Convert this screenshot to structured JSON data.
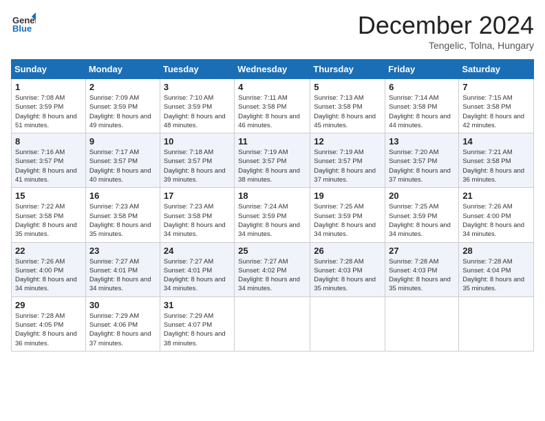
{
  "header": {
    "logo_line1": "General",
    "logo_line2": "Blue",
    "month_title": "December 2024",
    "location": "Tengelic, Tolna, Hungary"
  },
  "weekdays": [
    "Sunday",
    "Monday",
    "Tuesday",
    "Wednesday",
    "Thursday",
    "Friday",
    "Saturday"
  ],
  "weeks": [
    [
      {
        "day": "1",
        "sunrise": "7:08 AM",
        "sunset": "3:59 PM",
        "daylight": "8 hours and 51 minutes."
      },
      {
        "day": "2",
        "sunrise": "7:09 AM",
        "sunset": "3:59 PM",
        "daylight": "8 hours and 49 minutes."
      },
      {
        "day": "3",
        "sunrise": "7:10 AM",
        "sunset": "3:59 PM",
        "daylight": "8 hours and 48 minutes."
      },
      {
        "day": "4",
        "sunrise": "7:11 AM",
        "sunset": "3:58 PM",
        "daylight": "8 hours and 46 minutes."
      },
      {
        "day": "5",
        "sunrise": "7:13 AM",
        "sunset": "3:58 PM",
        "daylight": "8 hours and 45 minutes."
      },
      {
        "day": "6",
        "sunrise": "7:14 AM",
        "sunset": "3:58 PM",
        "daylight": "8 hours and 44 minutes."
      },
      {
        "day": "7",
        "sunrise": "7:15 AM",
        "sunset": "3:58 PM",
        "daylight": "8 hours and 42 minutes."
      }
    ],
    [
      {
        "day": "8",
        "sunrise": "7:16 AM",
        "sunset": "3:57 PM",
        "daylight": "8 hours and 41 minutes."
      },
      {
        "day": "9",
        "sunrise": "7:17 AM",
        "sunset": "3:57 PM",
        "daylight": "8 hours and 40 minutes."
      },
      {
        "day": "10",
        "sunrise": "7:18 AM",
        "sunset": "3:57 PM",
        "daylight": "8 hours and 39 minutes."
      },
      {
        "day": "11",
        "sunrise": "7:19 AM",
        "sunset": "3:57 PM",
        "daylight": "8 hours and 38 minutes."
      },
      {
        "day": "12",
        "sunrise": "7:19 AM",
        "sunset": "3:57 PM",
        "daylight": "8 hours and 37 minutes."
      },
      {
        "day": "13",
        "sunrise": "7:20 AM",
        "sunset": "3:57 PM",
        "daylight": "8 hours and 37 minutes."
      },
      {
        "day": "14",
        "sunrise": "7:21 AM",
        "sunset": "3:58 PM",
        "daylight": "8 hours and 36 minutes."
      }
    ],
    [
      {
        "day": "15",
        "sunrise": "7:22 AM",
        "sunset": "3:58 PM",
        "daylight": "8 hours and 35 minutes."
      },
      {
        "day": "16",
        "sunrise": "7:23 AM",
        "sunset": "3:58 PM",
        "daylight": "8 hours and 35 minutes."
      },
      {
        "day": "17",
        "sunrise": "7:23 AM",
        "sunset": "3:58 PM",
        "daylight": "8 hours and 34 minutes."
      },
      {
        "day": "18",
        "sunrise": "7:24 AM",
        "sunset": "3:59 PM",
        "daylight": "8 hours and 34 minutes."
      },
      {
        "day": "19",
        "sunrise": "7:25 AM",
        "sunset": "3:59 PM",
        "daylight": "8 hours and 34 minutes."
      },
      {
        "day": "20",
        "sunrise": "7:25 AM",
        "sunset": "3:59 PM",
        "daylight": "8 hours and 34 minutes."
      },
      {
        "day": "21",
        "sunrise": "7:26 AM",
        "sunset": "4:00 PM",
        "daylight": "8 hours and 34 minutes."
      }
    ],
    [
      {
        "day": "22",
        "sunrise": "7:26 AM",
        "sunset": "4:00 PM",
        "daylight": "8 hours and 34 minutes."
      },
      {
        "day": "23",
        "sunrise": "7:27 AM",
        "sunset": "4:01 PM",
        "daylight": "8 hours and 34 minutes."
      },
      {
        "day": "24",
        "sunrise": "7:27 AM",
        "sunset": "4:01 PM",
        "daylight": "8 hours and 34 minutes."
      },
      {
        "day": "25",
        "sunrise": "7:27 AM",
        "sunset": "4:02 PM",
        "daylight": "8 hours and 34 minutes."
      },
      {
        "day": "26",
        "sunrise": "7:28 AM",
        "sunset": "4:03 PM",
        "daylight": "8 hours and 35 minutes."
      },
      {
        "day": "27",
        "sunrise": "7:28 AM",
        "sunset": "4:03 PM",
        "daylight": "8 hours and 35 minutes."
      },
      {
        "day": "28",
        "sunrise": "7:28 AM",
        "sunset": "4:04 PM",
        "daylight": "8 hours and 35 minutes."
      }
    ],
    [
      {
        "day": "29",
        "sunrise": "7:28 AM",
        "sunset": "4:05 PM",
        "daylight": "8 hours and 36 minutes."
      },
      {
        "day": "30",
        "sunrise": "7:29 AM",
        "sunset": "4:06 PM",
        "daylight": "8 hours and 37 minutes."
      },
      {
        "day": "31",
        "sunrise": "7:29 AM",
        "sunset": "4:07 PM",
        "daylight": "8 hours and 38 minutes."
      },
      null,
      null,
      null,
      null
    ]
  ]
}
